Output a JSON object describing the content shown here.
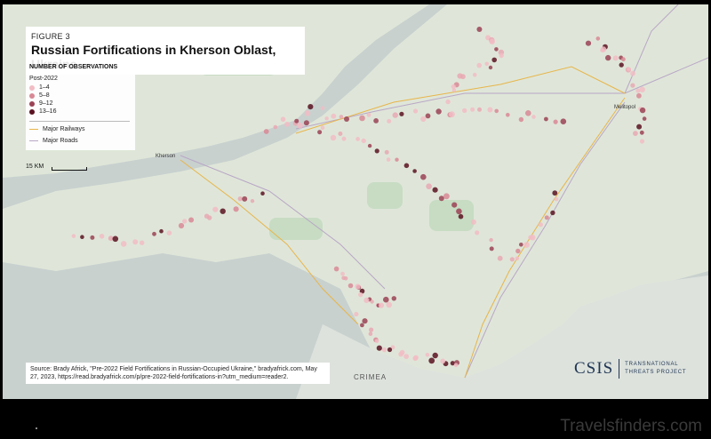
{
  "figure_label": "FIGURE 3",
  "title": "Russian Fortifications in Kherson Oblast, Ukraine",
  "legend": {
    "heading": "NUMBER OF OBSERVATIONS",
    "subheading": "Post-2022",
    "bins": [
      {
        "label": "1–4",
        "color": "#f2bcc4"
      },
      {
        "label": "5–8",
        "color": "#d98895"
      },
      {
        "label": "9–12",
        "color": "#9b4255"
      },
      {
        "label": "13–16",
        "color": "#5a1221"
      }
    ],
    "railways_label": "Major Railways",
    "roads_label": "Major Roads",
    "railway_color": "#e8b54a",
    "road_color": "#b9a7c6"
  },
  "scale_label": "15 KM",
  "places": {
    "kherson": "Kherson",
    "melitopol": "Melitopol",
    "crimea": "CRIMEA"
  },
  "source": "Source: Brady Africk, \"Pre-2022 Field Fortifications in Russian-Occupied Ukraine,\" bradyafrick.com, May 27, 2023, https://read.bradyafrick.com/p/pre-2022-field-fortifications-in?utm_medium=reader2.",
  "logo": {
    "name": "CSIS",
    "line1": "TRANSNATIONAL",
    "line2": "THREATS PROJECT"
  },
  "watermark": "Travelsfinders.com"
}
